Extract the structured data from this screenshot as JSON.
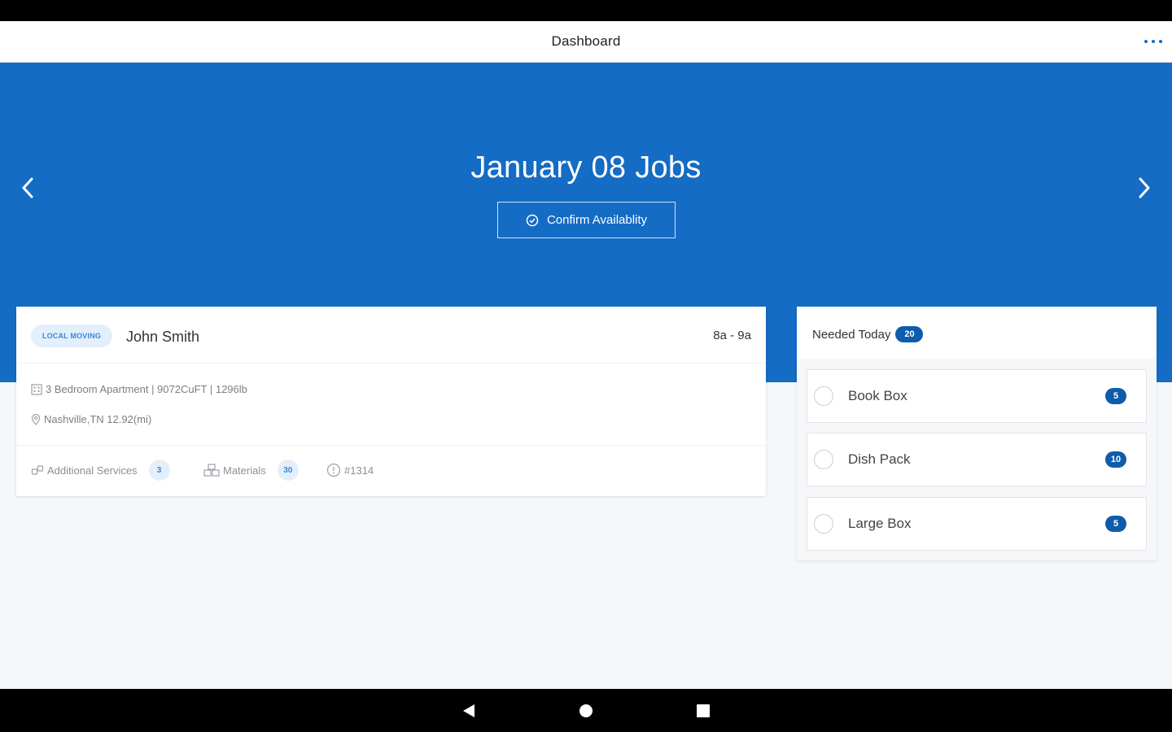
{
  "app_bar": {
    "title": "Dashboard"
  },
  "hero": {
    "title": "January 08 Jobs",
    "confirm_label": "Confirm Availablity"
  },
  "job": {
    "tag": "LOCAL MOVING",
    "customer": "John Smith",
    "time": "8a - 9a",
    "details": "3 Bedroom Apartment | 9072CuFT | 1296lb",
    "location": "Nashville,TN 12.92(mi)",
    "services_label": "Additional Services",
    "services_count": "3",
    "materials_label": "Materials",
    "materials_count": "30",
    "job_id": "#1314"
  },
  "needed_today": {
    "title": "Needed Today",
    "count": "20",
    "items": [
      {
        "label": "Book Box",
        "count": "5"
      },
      {
        "label": "Dish Pack",
        "count": "10"
      },
      {
        "label": "Large Box",
        "count": "5"
      }
    ]
  },
  "colors": {
    "primary": "#146cc4",
    "badge": "#0e5cac",
    "pill_bg": "#e3effb"
  }
}
